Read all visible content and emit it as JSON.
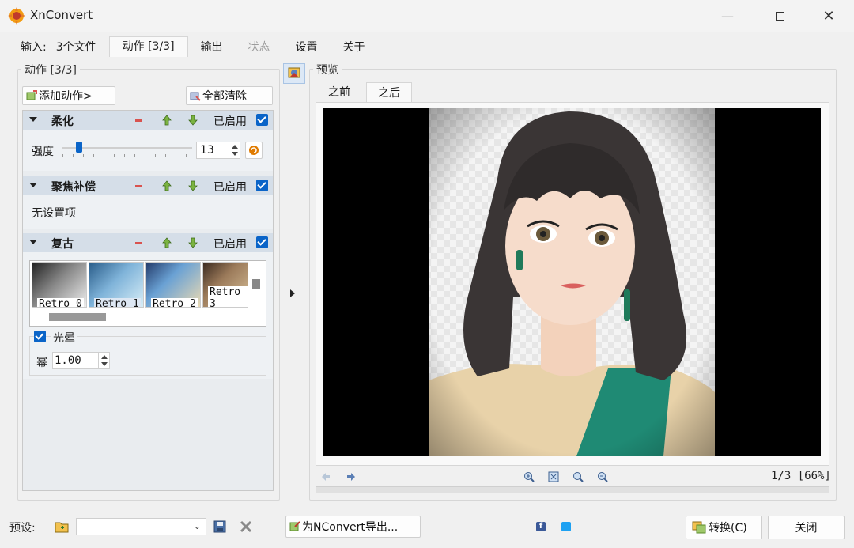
{
  "window": {
    "title": "XnConvert"
  },
  "tabs": {
    "input_label": "输入:",
    "input_value": "3个文件",
    "actions": "动作 [3/3]",
    "output": "输出",
    "status": "状态",
    "settings": "设置",
    "about": "关于"
  },
  "actions_panel": {
    "group_title": "动作 [3/3]",
    "add_action": "添加动作>",
    "clear_all": "全部清除",
    "sections": {
      "soften": {
        "title": "柔化",
        "enabled_label": "已启用",
        "strength_label": "强度",
        "strength_value": "13",
        "strength_fraction": 0.13
      },
      "focus": {
        "title": "聚焦补偿",
        "enabled_label": "已启用",
        "empty_text": "无设置项"
      },
      "retro": {
        "title": "复古",
        "enabled_label": "已启用",
        "thumbs": [
          "Retro 0",
          "Retro 1",
          "Retro 2",
          "Retro 3"
        ],
        "vignette_label": "光晕",
        "power_label": "幂",
        "power_value": "1.00"
      }
    }
  },
  "preview": {
    "group_title": "预览",
    "tab_before": "之前",
    "tab_after": "之后",
    "page_info": "1/3 [66%]"
  },
  "footer": {
    "preset_label": "预设:",
    "export_button": "为NConvert导出...",
    "convert_button": "转换(C)",
    "close_button": "关闭"
  },
  "colors": {
    "section_header": "#d5dee8",
    "checkbox": "#0a64c8",
    "accent": "#e07b00"
  }
}
